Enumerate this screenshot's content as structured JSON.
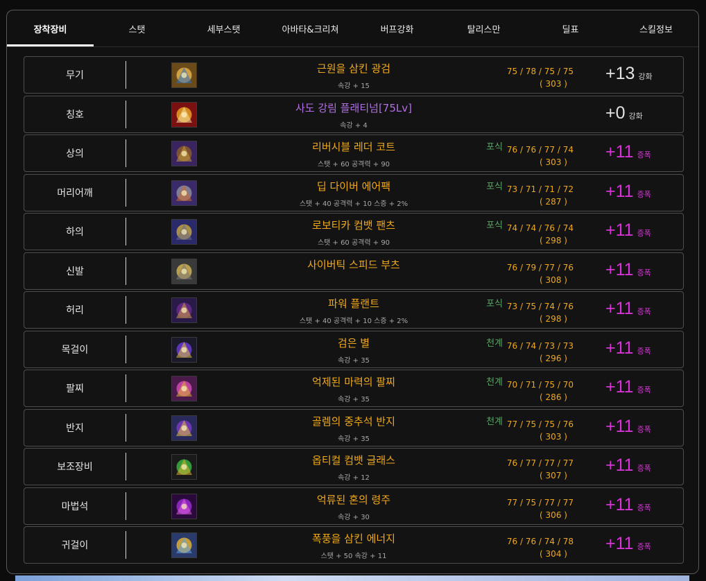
{
  "tabs": [
    "장착장비",
    "스탯",
    "세부스탯",
    "아바타&크리쳐",
    "버프강화",
    "탈리스만",
    "딜표",
    "스킬정보"
  ],
  "active_tab": "장착장비",
  "equipment": [
    {
      "slot": "무기",
      "name": "근원을 삼킨 광검",
      "option": "속강 + 15",
      "tag": "",
      "stats": "75 / 78 / 75 / 75",
      "total": "( 303 )",
      "reinforce": "+13",
      "reinforce_type": "강화",
      "name_color": "#f0a91a",
      "icon": "sword-icon"
    },
    {
      "slot": "칭호",
      "name": "사도 강림 플래티넘[75Lv]",
      "option": "속강 + 4",
      "tag": "",
      "stats": "",
      "total": "",
      "reinforce": "+0",
      "reinforce_type": "강화",
      "name_color": "#b26fe6",
      "icon": "title-emblem-icon"
    },
    {
      "slot": "상의",
      "name": "리버시블 레더 코트",
      "option": "스탯 + 60 공격력 + 90",
      "tag": "포식",
      "stats": "76 / 76 / 77 / 74",
      "total": "( 303 )",
      "reinforce": "+11",
      "reinforce_type": "증폭",
      "name_color": "#f0a91a",
      "icon": "coat-icon"
    },
    {
      "slot": "머리어깨",
      "name": "딥 다이버 에어팩",
      "option": "스탯 + 40 공격력 + 10 스증 + 2%",
      "tag": "포식",
      "stats": "73 / 71 / 71 / 72",
      "total": "( 287 )",
      "reinforce": "+11",
      "reinforce_type": "증폭",
      "name_color": "#f0a91a",
      "icon": "airpack-icon"
    },
    {
      "slot": "하의",
      "name": "로보티카 컴뱃 팬츠",
      "option": "스탯 + 60 공격력 + 90",
      "tag": "포식",
      "stats": "74 / 74 / 76 / 74",
      "total": "( 298 )",
      "reinforce": "+11",
      "reinforce_type": "증폭",
      "name_color": "#f0a91a",
      "icon": "pants-icon"
    },
    {
      "slot": "신발",
      "name": "사이버틱 스피드 부츠",
      "option": "",
      "tag": "",
      "stats": "76 / 79 / 77 / 76",
      "total": "( 308 )",
      "reinforce": "+11",
      "reinforce_type": "증폭",
      "name_color": "#f0a91a",
      "icon": "boots-icon"
    },
    {
      "slot": "허리",
      "name": "파워 플랜트",
      "option": "스탯 + 40 공격력 + 10 스증 + 2%",
      "tag": "포식",
      "stats": "73 / 75 / 74 / 76",
      "total": "( 298 )",
      "reinforce": "+11",
      "reinforce_type": "증폭",
      "name_color": "#f0a91a",
      "icon": "belt-icon"
    },
    {
      "slot": "목걸이",
      "name": "검은 별",
      "option": "속강 + 35",
      "tag": "천계",
      "stats": "76 / 74 / 73 / 73",
      "total": "( 296 )",
      "reinforce": "+11",
      "reinforce_type": "증폭",
      "name_color": "#f0a91a",
      "icon": "necklace-icon"
    },
    {
      "slot": "팔찌",
      "name": "억제된 마력의 팔찌",
      "option": "속강 + 35",
      "tag": "천계",
      "stats": "70 / 71 / 75 / 70",
      "total": "( 286 )",
      "reinforce": "+11",
      "reinforce_type": "증폭",
      "name_color": "#f0a91a",
      "icon": "bracelet-icon"
    },
    {
      "slot": "반지",
      "name": "골렘의 중추석 반지",
      "option": "속강 + 35",
      "tag": "천계",
      "stats": "77 / 75 / 75 / 76",
      "total": "( 303 )",
      "reinforce": "+11",
      "reinforce_type": "증폭",
      "name_color": "#f0a91a",
      "icon": "ring-icon"
    },
    {
      "slot": "보조장비",
      "name": "옵티컬 컴뱃 글래스",
      "option": "속강 + 12",
      "tag": "",
      "stats": "76 / 77 / 77 / 77",
      "total": "( 307 )",
      "reinforce": "+11",
      "reinforce_type": "증폭",
      "name_color": "#f0a91a",
      "icon": "glasses-icon"
    },
    {
      "slot": "마법석",
      "name": "억류된 혼의 령주",
      "option": "속강 + 30",
      "tag": "",
      "stats": "77 / 75 / 77 / 77",
      "total": "( 306 )",
      "reinforce": "+11",
      "reinforce_type": "증폭",
      "name_color": "#f0a91a",
      "icon": "magic-stone-icon"
    },
    {
      "slot": "귀걸이",
      "name": "폭풍을 삼킨 에너지",
      "option": "스탯 + 50 속강 + 11",
      "tag": "",
      "stats": "76 / 76 / 74 / 78",
      "total": "( 304 )",
      "reinforce": "+11",
      "reinforce_type": "증폭",
      "name_color": "#f0a91a",
      "icon": "earring-icon"
    }
  ],
  "colors": {
    "background": "#111111",
    "item_name": "#f0a91a",
    "title_name": "#b26fe6",
    "upgrade": "#d634d6",
    "tag": "#58a866",
    "option": "#a8a8a8"
  }
}
